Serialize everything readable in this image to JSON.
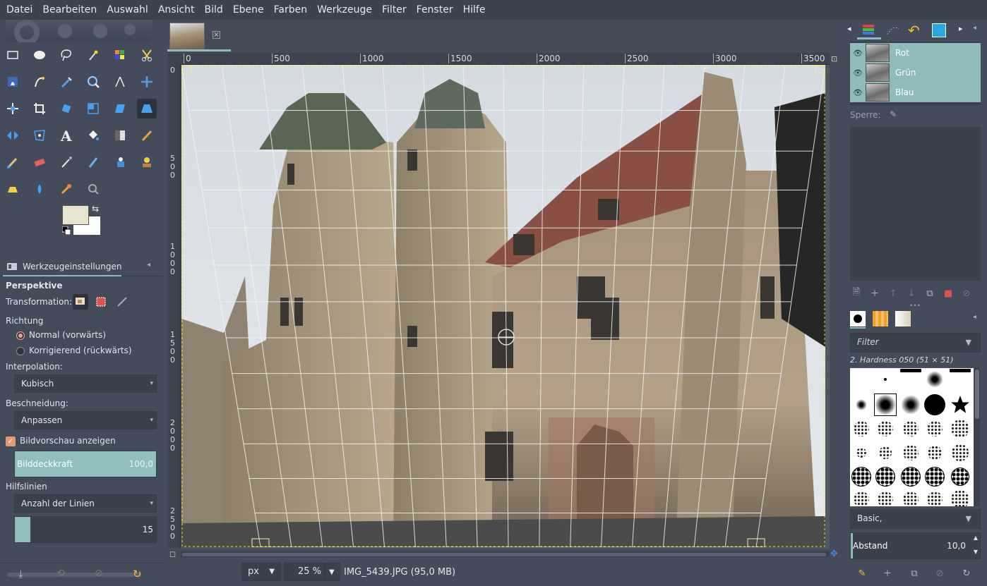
{
  "menu": [
    "Datei",
    "Bearbeiten",
    "Auswahl",
    "Ansicht",
    "Bild",
    "Ebene",
    "Farben",
    "Werkzeuge",
    "Filter",
    "Fenster",
    "Hilfe"
  ],
  "toolbox": {
    "tools": [
      "rect-select-icon",
      "ellipse-select-icon",
      "lasso-icon",
      "fuzzy-select-icon",
      "color-select-icon",
      "scissors-icon",
      "foreground-select-icon",
      "paths-icon",
      "color-picker-icon",
      "zoom-icon",
      "measure-icon",
      "move-icon",
      "align-icon",
      "crop-icon",
      "rotate-icon",
      "scale-icon",
      "shear-icon",
      "perspective-icon",
      "flip-icon",
      "cage-icon",
      "text-icon",
      "bucket-fill-icon",
      "gradient-icon",
      "pencil-icon",
      "paintbrush-icon",
      "eraser-icon",
      "airbrush-icon",
      "ink-icon",
      "clone-icon",
      "heal-icon",
      "perspective-clone-icon",
      "blur-icon",
      "smudge-icon",
      "dodge-icon"
    ],
    "colors": {
      "foreground": "#e8e3cc",
      "background": "#ffffff"
    }
  },
  "tool_options": {
    "tab_label": "Werkzeugeinstellungen",
    "title": "Perspektive",
    "transformation_label": "Transformation:",
    "direction_label": "Richtung",
    "direction_forward": "Normal (vorwärts)",
    "direction_backward": "Korrigierend (rückwärts)",
    "interpolation_label": "Interpolation:",
    "interpolation_value": "Kubisch",
    "clipping_label": "Beschneidung:",
    "clipping_value": "Anpassen",
    "show_preview_label": "Bildvorschau anzeigen",
    "opacity_label": "Bilddeckkraft",
    "opacity_value": "100,0",
    "opacity_fraction": 1.0,
    "guides_label": "Hilfslinien",
    "guides_value": "Anzahl der Linien",
    "lines_value": "15",
    "lines_fraction": 0.11
  },
  "canvas": {
    "ruler_h": [
      "0",
      "500",
      "1000",
      "1500",
      "2000",
      "2500",
      "3000",
      "3500"
    ],
    "ruler_v": [
      "0",
      "500",
      "1000",
      "1500",
      "2000",
      "2500"
    ],
    "unit": "px",
    "zoom": "25 %",
    "status": "IMG_5439.JPG (95,0 MB)"
  },
  "layers": {
    "items": [
      "Rot",
      "Grün",
      "Blau"
    ],
    "lock_label": "Sperre:"
  },
  "brushes": {
    "filter_placeholder": "Filter",
    "current": "2. Hardness 050 (51 × 51)",
    "preset": "Basic,",
    "spacing_label": "Abstand",
    "spacing_value": "10,0"
  }
}
